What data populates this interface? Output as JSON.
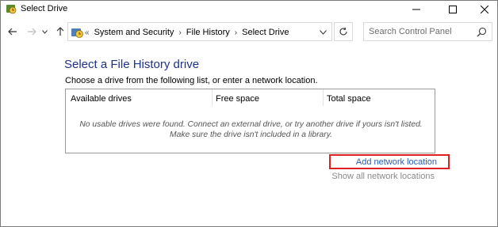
{
  "window": {
    "title": "Select Drive",
    "icons": {
      "app": "file-history-icon",
      "minimize": "minimize-icon",
      "maximize": "maximize-icon",
      "close": "close-icon"
    }
  },
  "nav": {
    "icons": {
      "back": "back-arrow-icon",
      "forward": "forward-arrow-icon",
      "recent": "chevron-down-icon",
      "up": "up-arrow-icon",
      "refresh": "refresh-icon"
    },
    "breadcrumb_lead": "«",
    "breadcrumbs": [
      "System and Security",
      "File History",
      "Select Drive"
    ],
    "separator": "›",
    "search_placeholder": "Search Control Panel"
  },
  "main": {
    "heading": "Select a File History drive",
    "instructions": "Choose a drive from the following list, or enter a network location.",
    "table": {
      "columns": [
        "Available drives",
        "Free space",
        "Total space"
      ],
      "empty_message": "No usable drives were found. Connect an external drive, or try another drive if yours isn't listed. Make sure the drive isn't included in a library."
    },
    "links": {
      "add_network": "Add network location",
      "show_all": "Show all network locations"
    }
  },
  "colors": {
    "heading": "#1e3287",
    "link": "#2a5db0",
    "highlight": "#e02020",
    "disabled_link": "#8a8a8a"
  }
}
